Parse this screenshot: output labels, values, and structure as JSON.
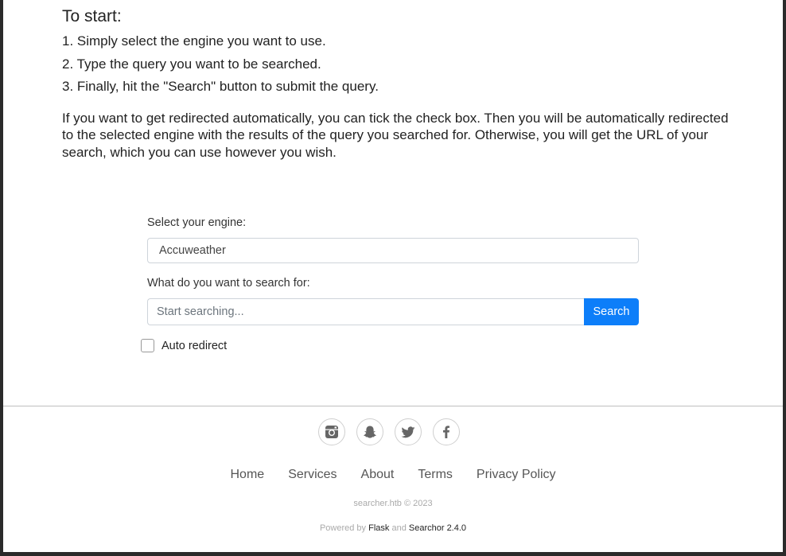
{
  "intro": {
    "heading": "To start:",
    "steps": [
      "1. Simply select the engine you want to use.",
      "2. Type the query you want to be searched.",
      "3. Finally, hit the \"Search\" button to submit the query."
    ],
    "paragraph": "If you want to get redirected automatically, you can tick the check box. Then you will be automatically redirected to the selected engine with the results of the query you searched for. Otherwise, you will get the URL of your search, which you can use however you wish."
  },
  "form": {
    "engine_label": "Select your engine:",
    "engine_value": "Accuweather",
    "query_label": "What do you want to search for:",
    "query_placeholder": "Start searching...",
    "query_value": "",
    "search_button": "Search",
    "auto_redirect_label": "Auto redirect",
    "auto_redirect_checked": false,
    "accent_color": "#0d7ef9"
  },
  "footer": {
    "social": [
      "instagram-icon",
      "snapchat-icon",
      "twitter-icon",
      "facebook-icon"
    ],
    "nav": [
      "Home",
      "Services",
      "About",
      "Terms",
      "Privacy Policy"
    ],
    "copyright": "searcher.htb © 2023",
    "powered_prefix": "Powered by",
    "powered_flask": "Flask",
    "powered_and": "and",
    "powered_searchor": "Searchor 2.4.0"
  }
}
